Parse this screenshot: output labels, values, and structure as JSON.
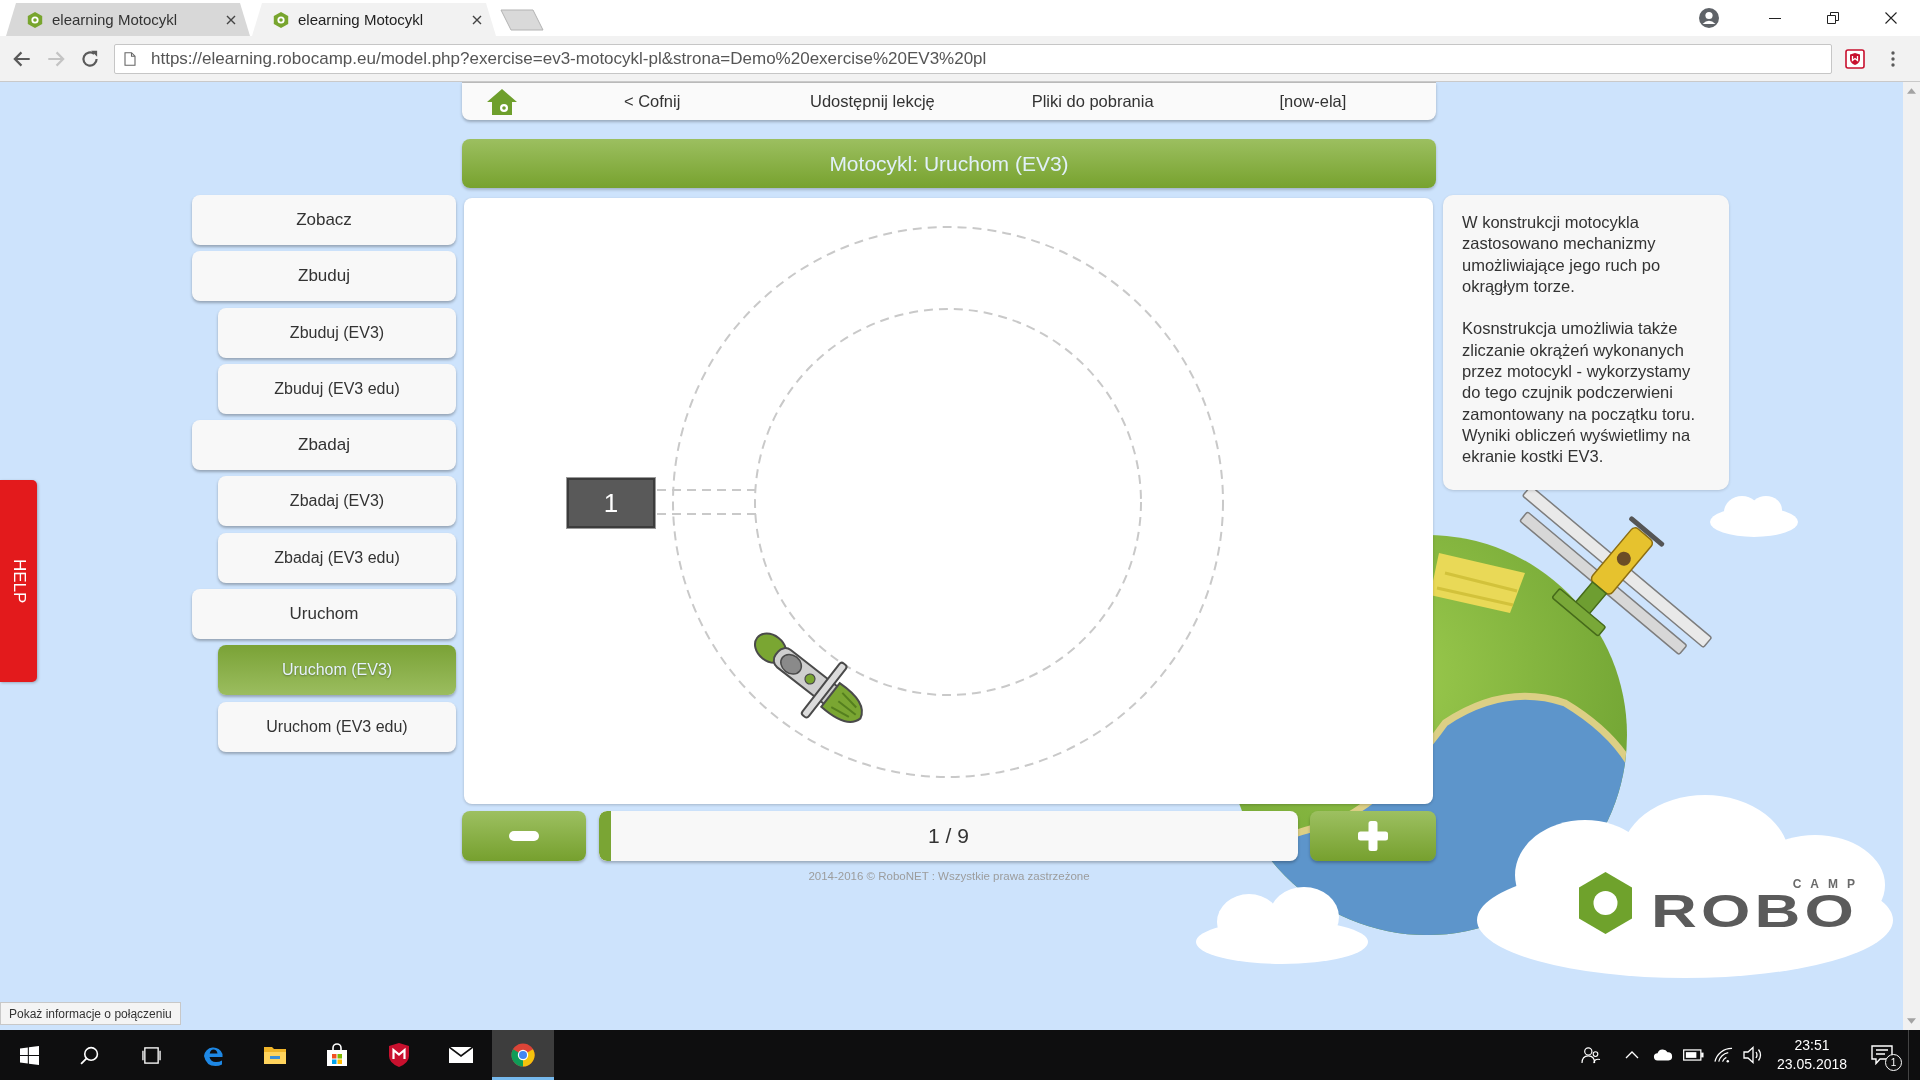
{
  "browser": {
    "tabs": [
      {
        "title": "elearning Motocykl",
        "selected": false
      },
      {
        "title": "elearning Motocykl",
        "selected": true
      }
    ],
    "nav_buttons": [
      {
        "kind": "back",
        "disabled": false
      },
      {
        "kind": "forward",
        "disabled": true
      },
      {
        "kind": "reload",
        "disabled": false
      }
    ],
    "url": "https://elearning.robocamp.eu/model.php?exercise=ev3-motocykl-pl&strona=Demo%20exercise%20EV3%20pl"
  },
  "nav": [
    "< Cofnij",
    "Udostępnij lekcję",
    "Pliki do pobrania",
    "[now-ela]"
  ],
  "title": "Motocykl: Uruchom (EV3)",
  "sidebar": [
    {
      "label": "Zobacz",
      "selected": false
    },
    {
      "label": "Zbuduj",
      "selected": false,
      "children": [
        {
          "label": "Zbuduj (EV3)",
          "selected": false
        },
        {
          "label": "Zbuduj (EV3 edu)",
          "selected": false
        }
      ]
    },
    {
      "label": "Zbadaj",
      "selected": false,
      "children": [
        {
          "label": "Zbadaj (EV3)",
          "selected": false
        },
        {
          "label": "Zbadaj (EV3 edu)",
          "selected": false
        }
      ]
    },
    {
      "label": "Uruchom",
      "selected": false,
      "children": [
        {
          "label": "Uruchom (EV3)",
          "selected": true
        },
        {
          "label": "Uruchom (EV3 edu)",
          "selected": false
        }
      ]
    }
  ],
  "help": "HELP",
  "stage": {
    "counter": "1"
  },
  "description": [
    "W konstrukcji motocykla zastosowano mechanizmy umożliwiające jego ruch po okrągłym torze.",
    "Kosnstrukcja umożliwia także zliczanie okrążeń wykonanych przez motocykl - wykorzystamy do tego czujnik podczerwieni zamontowany na początku toru. Wyniki obliczeń wyświetlimy na ekranie kostki EV3."
  ],
  "pager": {
    "level": 0.017,
    "reading": "1 / 9"
  },
  "footer": "2014-2016 © RoboNET : Wszystkie prawa zastrzeżone",
  "logo": {
    "tag": "CAMP",
    "name": "ROBO"
  },
  "status_tooltip": "Pokaż informacje o połączeniu",
  "taskbar": {
    "apps": [
      {
        "kind": "start",
        "selected": false
      },
      {
        "kind": "search",
        "selected": false
      },
      {
        "kind": "task_view",
        "selected": false
      },
      {
        "kind": "edge",
        "selected": false
      },
      {
        "kind": "explorer",
        "selected": false
      },
      {
        "kind": "store",
        "selected": false
      },
      {
        "kind": "mcafee",
        "selected": false
      },
      {
        "kind": "mail",
        "selected": false
      },
      {
        "kind": "chrome",
        "selected": true
      }
    ],
    "time": "23:51",
    "date": "23.05.2018",
    "notifications": "1"
  }
}
